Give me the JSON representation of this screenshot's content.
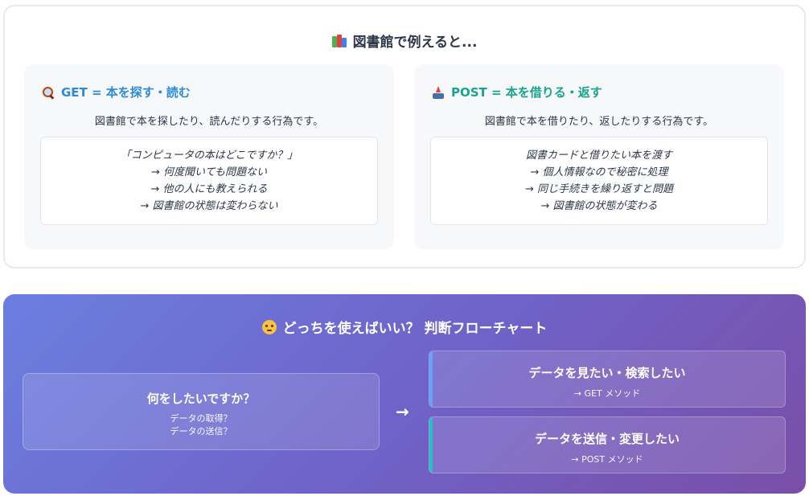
{
  "analogy": {
    "title": "図書館で例えると...",
    "title_icon": "books-icon",
    "get": {
      "heading": "GET = 本を探す・読む",
      "heading_icon": "magnifier-icon",
      "color": "#2b8bd6",
      "description": "図書館で本を探したり、読んだりする行為です。",
      "lines": [
        "「コンピュータの本はどこですか？」",
        "→ 何度聞いても問題ない",
        "→ 他の人にも教えられる",
        "→ 図書館の状態は変わらない"
      ]
    },
    "post": {
      "heading": "POST = 本を借りる・返す",
      "heading_icon": "outbox-tray-icon",
      "color": "#16a58c",
      "description": "図書館で本を借りたり、返したりする行為です。",
      "lines": [
        "図書カードと借りたい本を渡す",
        "→ 個人情報なので秘密に処理",
        "→ 同じ手続きを繰り返すと問題",
        "→ 図書館の状態が変わる"
      ]
    }
  },
  "flowchart": {
    "title": "どっちを使えばいい？ 判断フローチャート",
    "title_icon": "thinking-face-icon",
    "question": {
      "title": "何をしたいですか？",
      "lines": [
        "データの取得？",
        "データの送信？"
      ]
    },
    "arrow": "→",
    "answers": [
      {
        "title": "データを見たい・検索したい",
        "method": "→ GET メソッド",
        "accent": "#60a5fa"
      },
      {
        "title": "データを送信・変更したい",
        "method": "→ POST メソッド",
        "accent": "#22c1c3"
      }
    ]
  }
}
